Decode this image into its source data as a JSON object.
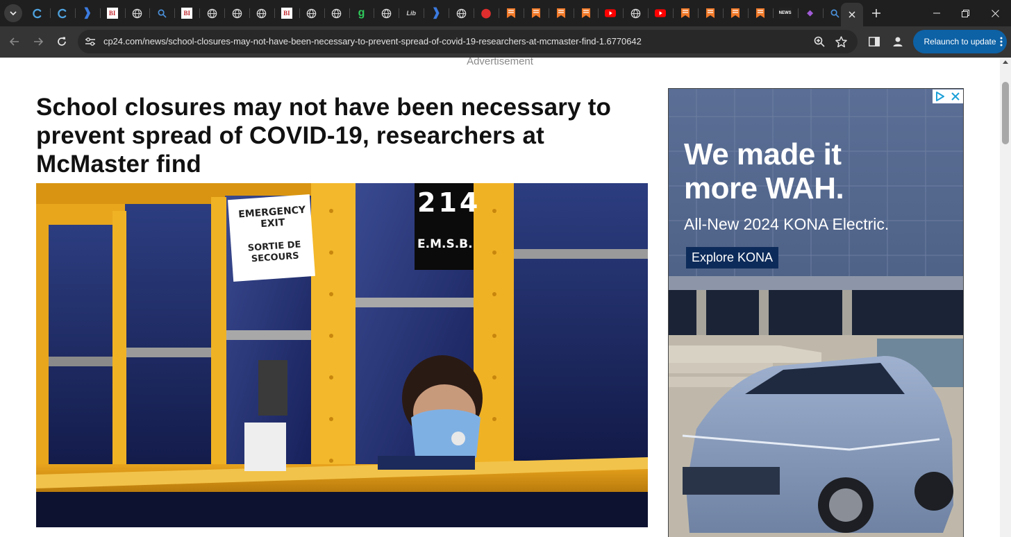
{
  "browser": {
    "tabs": [
      {
        "icon": "globe-icon"
      },
      {
        "icon": "search-icon"
      },
      {
        "icon": "flag-icon"
      },
      {
        "icon": "bookmark-icon"
      }
    ],
    "tab_favicons": [
      {
        "icon": "sky-c-icon",
        "glyph": "C",
        "color": "#4fa3e0",
        "bg": ""
      },
      {
        "icon": "sky-c-icon",
        "glyph": "C",
        "color": "#4fa3e0",
        "bg": ""
      },
      {
        "icon": "arrow-logo-icon",
        "glyph": "❱",
        "color": "#3b7be0",
        "bg": ""
      },
      {
        "icon": "bi-logo-icon",
        "glyph": "BI",
        "color": "#c0262d",
        "bg": "#ffffff"
      },
      {
        "icon": "globe-icon",
        "glyph": "",
        "color": "#d5d5d5",
        "bg": ""
      },
      {
        "icon": "search-icon",
        "glyph": "",
        "color": "#4a90d9",
        "bg": ""
      },
      {
        "icon": "bi-logo-icon",
        "glyph": "BI",
        "color": "#c0262d",
        "bg": "#ffffff"
      },
      {
        "icon": "globe-icon",
        "glyph": "",
        "color": "#d5d5d5",
        "bg": ""
      },
      {
        "icon": "globe-icon",
        "glyph": "",
        "color": "#d5d5d5",
        "bg": ""
      },
      {
        "icon": "globe-icon",
        "glyph": "",
        "color": "#d5d5d5",
        "bg": ""
      },
      {
        "icon": "bi-logo-icon",
        "glyph": "BI",
        "color": "#c0262d",
        "bg": "#ffffff"
      },
      {
        "icon": "globe-icon",
        "glyph": "",
        "color": "#d5d5d5",
        "bg": ""
      },
      {
        "icon": "globe-icon",
        "glyph": "",
        "color": "#d5d5d5",
        "bg": ""
      },
      {
        "icon": "g-logo-icon",
        "glyph": "g",
        "color": "#2fc95b",
        "bg": ""
      },
      {
        "icon": "globe-icon",
        "glyph": "",
        "color": "#d5d5d5",
        "bg": ""
      },
      {
        "icon": "lib-logo-icon",
        "glyph": "Lib",
        "color": "#cfcfcf",
        "bg": ""
      },
      {
        "icon": "arrow-logo-icon",
        "glyph": "❱",
        "color": "#3b7be0",
        "bg": ""
      },
      {
        "icon": "globe-icon",
        "glyph": "",
        "color": "#d5d5d5",
        "bg": ""
      },
      {
        "icon": "pin-logo-icon",
        "glyph": "⬤",
        "color": "#e02d2d",
        "bg": ""
      },
      {
        "icon": "bookmark-logo-icon",
        "glyph": "",
        "color": "#f07a2a",
        "bg": ""
      },
      {
        "icon": "bookmark-logo-icon",
        "glyph": "",
        "color": "#f07a2a",
        "bg": ""
      },
      {
        "icon": "bookmark-logo-icon",
        "glyph": "",
        "color": "#f07a2a",
        "bg": ""
      },
      {
        "icon": "bookmark-logo-icon",
        "glyph": "",
        "color": "#f07a2a",
        "bg": ""
      },
      {
        "icon": "youtube-icon",
        "glyph": "▶",
        "color": "#ff0000",
        "bg": ""
      },
      {
        "icon": "globe-icon",
        "glyph": "",
        "color": "#d5d5d5",
        "bg": ""
      },
      {
        "icon": "youtube-icon",
        "glyph": "▶",
        "color": "#ff0000",
        "bg": ""
      },
      {
        "icon": "bookmark-logo-icon",
        "glyph": "",
        "color": "#f07a2a",
        "bg": ""
      },
      {
        "icon": "bookmark-logo-icon",
        "glyph": "",
        "color": "#f07a2a",
        "bg": ""
      },
      {
        "icon": "bookmark-logo-icon",
        "glyph": "",
        "color": "#f07a2a",
        "bg": ""
      },
      {
        "icon": "bookmark-logo-icon",
        "glyph": "",
        "color": "#f07a2a",
        "bg": ""
      },
      {
        "icon": "news-logo-icon",
        "glyph": "NEWS",
        "color": "#ffffff",
        "bg": "#222222"
      },
      {
        "icon": "shop-logo-icon",
        "glyph": "◆",
        "color": "#a05bd6",
        "bg": ""
      },
      {
        "icon": "search-icon",
        "glyph": "",
        "color": "#4a90d9",
        "bg": ""
      }
    ],
    "omnibox": {
      "url": "cp24.com/news/school-closures-may-not-have-been-necessary-to-prevent-spread-of-covid-19-researchers-at-mcmaster-find-1.6770642"
    },
    "relaunch_label": "Relaunch to update"
  },
  "page": {
    "advertisement_label": "Advertisement",
    "headline": "School closures may not have been necessary to prevent spread of COVID-19, researchers at McMaster find",
    "hero_image": {
      "bus_number": "214",
      "bus_owner": "E.M.S.B.",
      "sign_line1": "EMERGENCY EXIT",
      "sign_line2": "SORTIE DE SECOURS"
    }
  },
  "side_ad": {
    "headline": "We made it more WAH.",
    "headline_line1": "We made it",
    "headline_line2": "more WAH.",
    "subhead": "All-New 2024 KONA Electric.",
    "cta": "Explore KONA"
  }
}
